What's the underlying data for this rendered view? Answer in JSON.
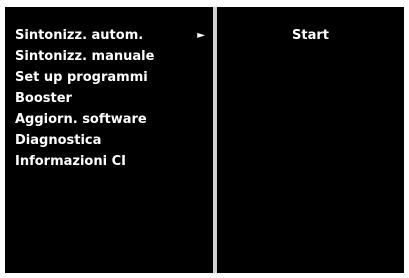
{
  "menu": {
    "items": [
      {
        "label": "Sintonizz. autom.",
        "selected": true,
        "has_submenu": true
      },
      {
        "label": "Sintonizz. manuale"
      },
      {
        "label": "Set up programmi"
      },
      {
        "label": "Booster"
      },
      {
        "label": "Aggiorn. software"
      },
      {
        "label": "Diagnostica"
      },
      {
        "label": "Informazioni CI"
      }
    ],
    "arrow_icon": "right-triangle-icon"
  },
  "submenu": {
    "items": [
      {
        "label": "Start"
      }
    ]
  },
  "colors": {
    "background": "#000000",
    "text": "#ffffff",
    "divider": "#cfcfcf"
  }
}
